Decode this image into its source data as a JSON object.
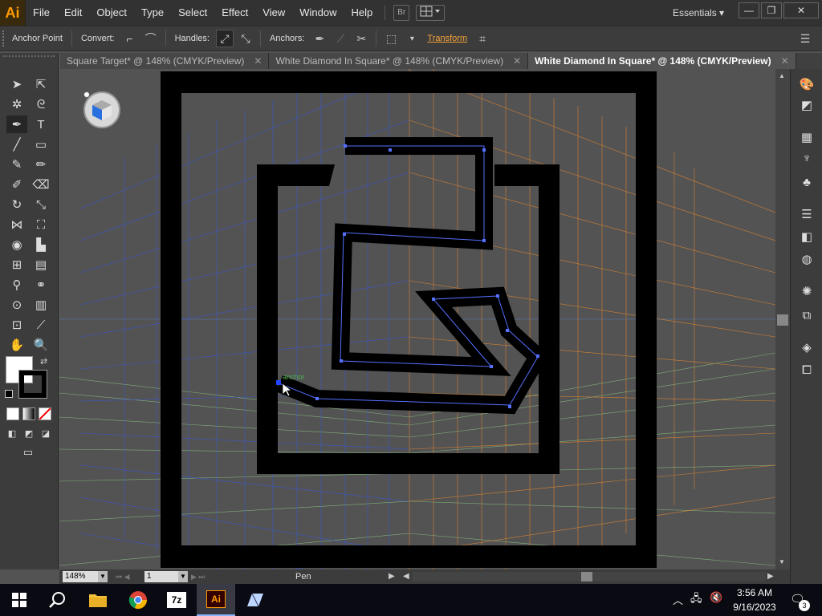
{
  "app": {
    "logo": "Ai"
  },
  "menu": [
    "File",
    "Edit",
    "Object",
    "Type",
    "Select",
    "Effect",
    "View",
    "Window",
    "Help"
  ],
  "bridge_button": "Br",
  "workspace": "Essentials",
  "window_controls": {
    "minimize": "—",
    "restore": "❐",
    "close": "✕"
  },
  "control_bar": {
    "selection_label": "Anchor Point",
    "convert_label": "Convert:",
    "handles_label": "Handles:",
    "anchors_label": "Anchors:",
    "transform_link": "Transform"
  },
  "tabs": [
    {
      "label": "Square Target* @ 148% (CMYK/Preview)",
      "close": "✕"
    },
    {
      "label": "White Diamond In Square* @ 148% (CMYK/Preview)",
      "close": "✕"
    },
    {
      "label": "White Diamond In Square* @ 148% (CMYK/Preview)",
      "close": "✕"
    }
  ],
  "canvas": {
    "anchor_hint": "anchor"
  },
  "status": {
    "zoom": "148%",
    "artboard": "1",
    "current_tool": "Pen"
  },
  "taskbar": {
    "time": "3:56 AM",
    "date": "9/16/2023",
    "notification_count": "3",
    "apps": [
      "start-icon",
      "search-icon",
      "file-explorer-icon",
      "chrome-icon",
      "7zip-icon",
      "illustrator-icon",
      "app-icon"
    ]
  },
  "colors": {
    "accent": "#f4a23a",
    "ui_dark": "#323232",
    "canvas_bg": "#535353",
    "grid_left": "#3a57d6",
    "grid_right": "#e3862f",
    "grid_floor": "#8fcf85"
  }
}
